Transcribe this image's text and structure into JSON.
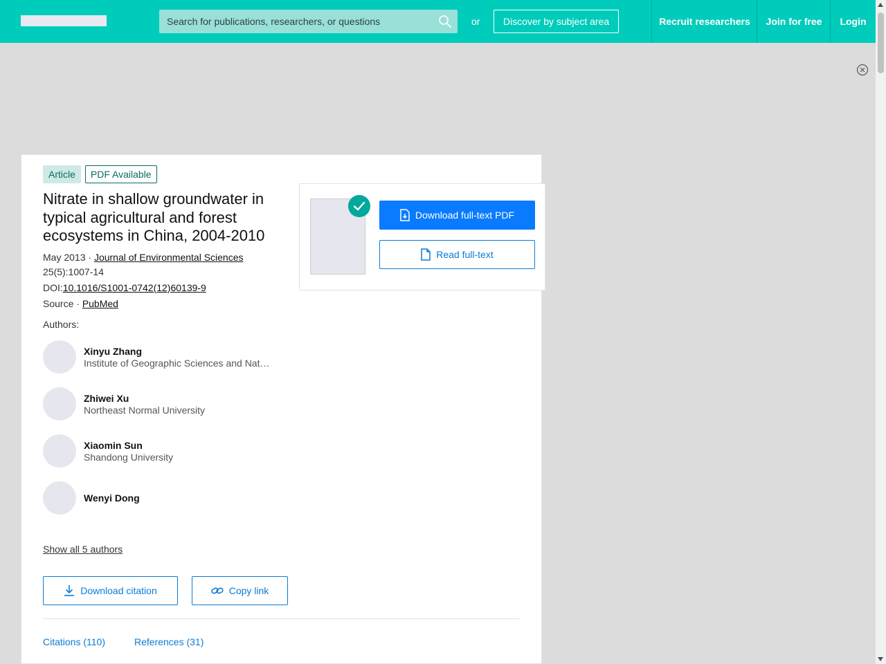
{
  "header": {
    "search_placeholder": "Search for publications, researchers, or questions",
    "or_text": "or",
    "discover_label": "Discover by subject area",
    "nav": {
      "recruit": "Recruit researchers",
      "join": "Join for free",
      "login": "Login"
    }
  },
  "article": {
    "type_badge": "Article",
    "pdf_badge": "PDF Available",
    "title": "Nitrate in shallow groundwater in typical agricultural and forest ecosystems in China, 2004-2010",
    "date": "May 2013",
    "separator": " · ",
    "journal": "Journal of Environmental Sciences",
    "pages": "25(5):1007-14",
    "doi_label": "DOI:",
    "doi": "10.1016/S1001-0742(12)60139-9",
    "source_label": "Source · ",
    "source": "PubMed",
    "authors_label": "Authors:",
    "authors": [
      {
        "name": "Xinyu Zhang",
        "institution": "Institute of Geographic Sciences and Natural Resources Research"
      },
      {
        "name": "Zhiwei Xu",
        "institution": "Northeast Normal University"
      },
      {
        "name": "Xiaomin Sun",
        "institution": "Shandong University"
      },
      {
        "name": "Wenyi Dong",
        "institution": ""
      }
    ],
    "show_all": "Show all 5 authors",
    "download_citation": "Download citation",
    "copy_link": "Copy link",
    "tabs": {
      "citations": "Citations (110)",
      "references": "References (31)"
    }
  },
  "pdf_panel": {
    "download_pdf": "Download full-text PDF",
    "read_fulltext": "Read full-text"
  },
  "colors": {
    "brand": "#00ccbb",
    "accent_blue": "#0a7bff",
    "link_blue": "#0a7bd6"
  }
}
